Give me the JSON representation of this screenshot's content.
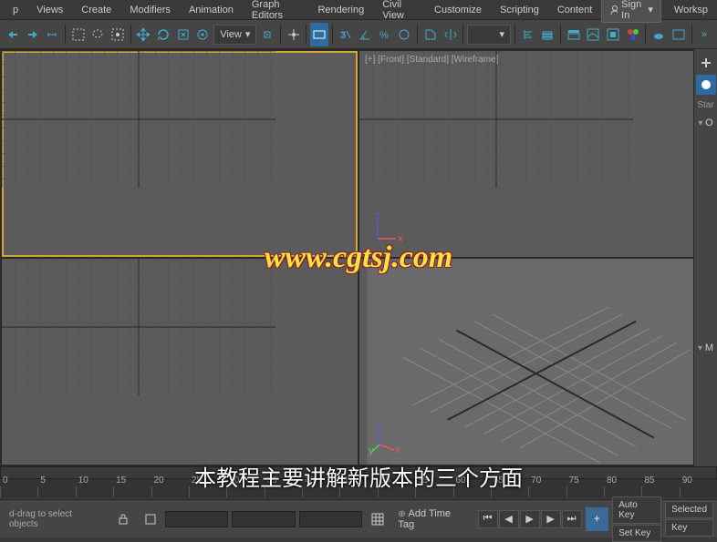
{
  "menu": {
    "items": [
      "p",
      "Views",
      "Create",
      "Modifiers",
      "Animation",
      "Graph Editors",
      "Rendering",
      "Civil View",
      "Customize",
      "Scripting",
      "Content"
    ],
    "signin": "Sign In",
    "workspace": "Worksp"
  },
  "toolbar": {
    "view_label": "View"
  },
  "viewports": {
    "front_label": "[+] [Front] [Standard] [Wireframe]"
  },
  "rightpanel": {
    "start": "Star",
    "section_o": "O",
    "section_m": "M"
  },
  "timeline": {
    "ticks": [
      "0",
      "5",
      "10",
      "15",
      "20",
      "25",
      "30",
      "35",
      "40",
      "45",
      "50",
      "55",
      "60",
      "65",
      "70",
      "75",
      "80",
      "85",
      "90"
    ],
    "add_time_tag": "Add Time Tag"
  },
  "status": {
    "hint": "d-drag to select objects",
    "autokey": "Auto Key",
    "selected": "Selected",
    "setkey": "Set Key",
    "keyfilters": "Key"
  },
  "watermark": "www.cgtsj.com",
  "subtitle": "本教程主要讲解新版本的三个方面"
}
